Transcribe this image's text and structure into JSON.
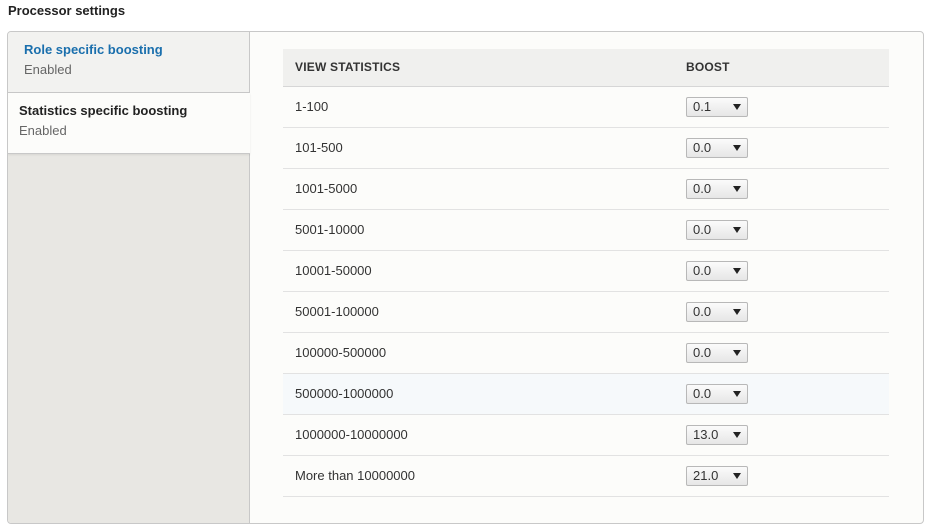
{
  "page": {
    "title": "Processor settings"
  },
  "tabs": [
    {
      "title": "Role specific boosting",
      "summary": "Enabled",
      "active": false
    },
    {
      "title": "Statistics specific boosting",
      "summary": "Enabled",
      "active": true
    }
  ],
  "table": {
    "headers": {
      "statistics": "VIEW STATISTICS",
      "boost": "BOOST"
    },
    "rows": [
      {
        "range": "1-100",
        "boost": "0.1"
      },
      {
        "range": "101-500",
        "boost": "0.0"
      },
      {
        "range": "1001-5000",
        "boost": "0.0"
      },
      {
        "range": "5001-10000",
        "boost": "0.0"
      },
      {
        "range": "10001-50000",
        "boost": "0.0"
      },
      {
        "range": "50001-100000",
        "boost": "0.0"
      },
      {
        "range": "100000-500000",
        "boost": "0.0"
      },
      {
        "range": "500000-1000000",
        "boost": "0.0"
      },
      {
        "range": "1000000-10000000",
        "boost": "13.0"
      },
      {
        "range": "More than 10000000",
        "boost": "21.0"
      }
    ]
  },
  "colors": {
    "link": "#1a6fad",
    "sidebar_bg": "#e8e7e3",
    "panel_bg": "#fcfcfa",
    "border": "#c8c8c8"
  },
  "icons": {
    "select_caret": "chevron-down-icon"
  }
}
